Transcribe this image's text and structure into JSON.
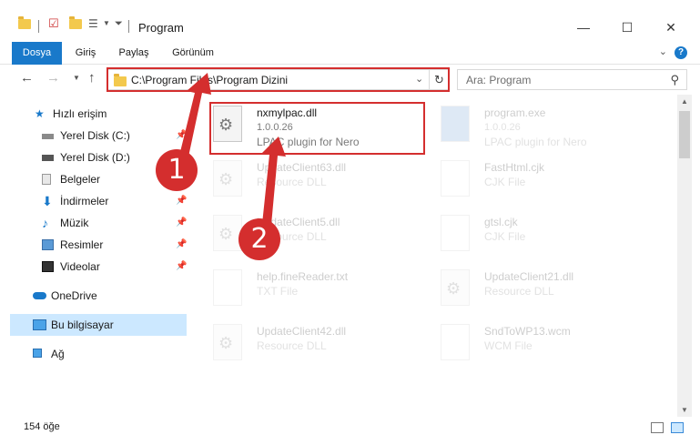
{
  "window": {
    "title": "Program",
    "minimize_glyph": "—",
    "maximize_glyph": "☐",
    "close_glyph": "✕"
  },
  "ribbon": {
    "tabs": [
      "Dosya",
      "Giriş",
      "Paylaş",
      "Görünüm"
    ],
    "help_glyph": "?",
    "collapse_glyph": "⌄"
  },
  "address": {
    "path": "C:\\Program Files\\Program Dizini",
    "search_placeholder": "Ara: Program"
  },
  "nav": {
    "items": [
      {
        "label": "Hızlı erişim",
        "icon": "star-icon",
        "pinned": false
      },
      {
        "label": "Yerel Disk (C:)",
        "icon": "drive-icon",
        "pinned": true
      },
      {
        "label": "Yerel Disk (D:)",
        "icon": "drive-icon",
        "pinned": true
      },
      {
        "label": "Belgeler",
        "icon": "documents-icon",
        "pinned": true
      },
      {
        "label": "İndirmeler",
        "icon": "download-icon",
        "pinned": true
      },
      {
        "label": "Müzik",
        "icon": "music-icon",
        "pinned": true
      },
      {
        "label": "Resimler",
        "icon": "pictures-icon",
        "pinned": true
      },
      {
        "label": "Videolar",
        "icon": "videos-icon",
        "pinned": true
      },
      {
        "label": "OneDrive",
        "icon": "cloud-icon",
        "pinned": false
      },
      {
        "label": "Bu bilgisayar",
        "icon": "computer-icon",
        "pinned": false,
        "selected": true
      },
      {
        "label": "Ağ",
        "icon": "network-icon",
        "pinned": false
      }
    ]
  },
  "files": [
    {
      "name": "nxmylpac.dll",
      "version": "1.0.0.26",
      "desc": "LPAC plugin for Nero",
      "highlight": true
    },
    {
      "name": "program.exe",
      "version": "1.0.0.26",
      "desc": "LPAC plugin for Nero"
    },
    {
      "name": "UpdateClient63.dll",
      "version": "",
      "desc": "Resource DLL"
    },
    {
      "name": "FastHtml.cjk",
      "version": "",
      "desc": "CJK File"
    },
    {
      "name": "UpdateClient5.dll",
      "version": "",
      "desc": "Resource DLL"
    },
    {
      "name": "gtsl.cjk",
      "version": "",
      "desc": "CJK File"
    },
    {
      "name": "help.fineReader.txt",
      "version": "",
      "desc": "TXT File"
    },
    {
      "name": "UpdateClient21.dll",
      "version": "",
      "desc": "Resource DLL"
    },
    {
      "name": "UpdateClient42.dll",
      "version": "",
      "desc": "Resource DLL"
    },
    {
      "name": "SndToWP13.wcm",
      "version": "",
      "desc": "WCM File"
    }
  ],
  "status": {
    "count": "154 öğe"
  },
  "annotations": {
    "badge1": "1",
    "badge2": "2",
    "color": "#d42e2e"
  },
  "colors": {
    "accent": "#1979ca",
    "selection": "#cce8ff",
    "highlight": "#d42e2e"
  }
}
